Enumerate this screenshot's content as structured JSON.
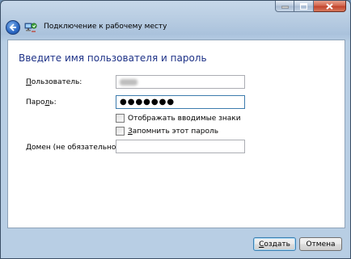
{
  "window": {
    "title": "Подключение к рабочему месту"
  },
  "main": {
    "heading": "Введите имя пользователя и пароль",
    "username": {
      "label_accel": "П",
      "label_rest": "ользователь:"
    },
    "password": {
      "label_pre": "Паро",
      "label_accel": "л",
      "label_post": "ь:",
      "masked_value": "●●●●●●●"
    },
    "show_chars": {
      "label": "Отображать вводимые знаки",
      "checked": false
    },
    "remember": {
      "label_accel": "З",
      "label_rest": "апомнить этот пароль",
      "checked": false
    },
    "domain": {
      "label": "Домен (не обязательно):",
      "value": ""
    }
  },
  "footer": {
    "create_accel": "С",
    "create_rest": "оздать",
    "cancel_label": "Отмена"
  },
  "icons": {
    "back": "back-arrow-icon",
    "app": "network-connection-icon",
    "minimize": "minimize-icon",
    "maximize": "maximize-icon",
    "close": "close-icon"
  }
}
